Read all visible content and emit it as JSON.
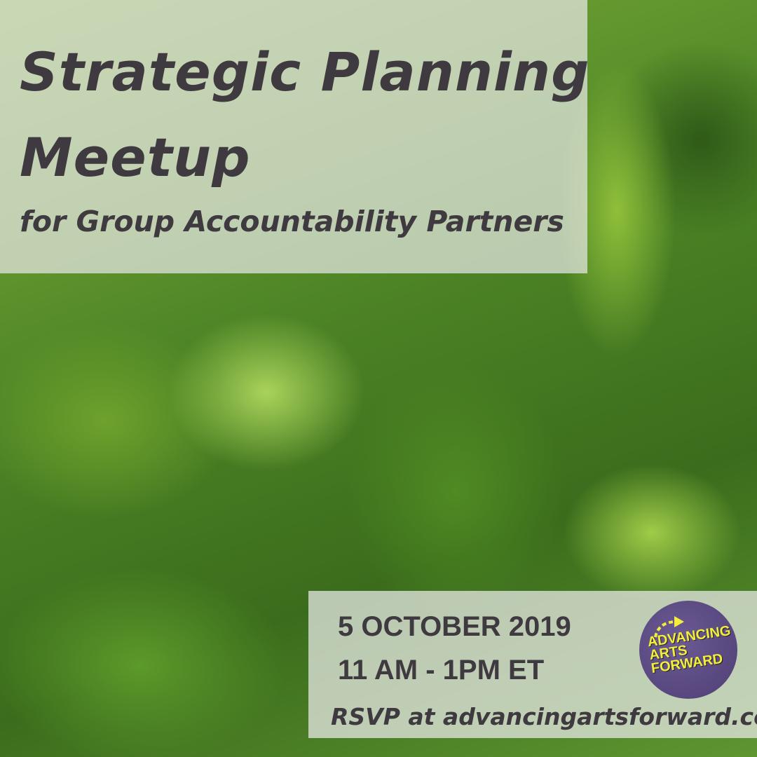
{
  "title_line1": "Strategic Planning",
  "title_line2": "Meetup",
  "subtitle": "for Group Accountability Partners",
  "date": "5 OCTOBER 2019",
  "time": "11 AM - 1PM ET",
  "rsvp": "RSVP at advancingartsforward.com",
  "logo": {
    "line1": "ADVANCING",
    "line2": "ARTS",
    "line3": "FORWARD",
    "bg_color": "#5a4a82",
    "text_color": "#f2ee3a"
  },
  "text_color": "#3f3a40"
}
